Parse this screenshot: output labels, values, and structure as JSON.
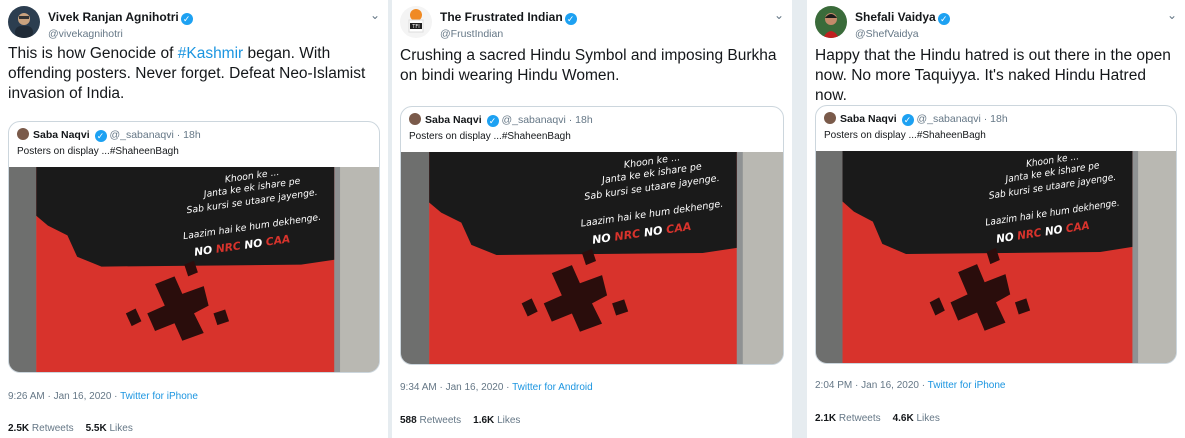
{
  "tweets": [
    {
      "author": "Vivek Ranjan Agnihotri",
      "handle": "@vivekagnihotri",
      "text_before": "This is how Genocide of ",
      "hashtag": "#Kashmir",
      "text_after": " began. With offending posters. Never forget. Defeat Neo-Islamist invasion of India.",
      "time": "9:26 AM · Jan 16, 2020 · ",
      "source": "Twitter for iPhone",
      "retweets_count": "2.5K",
      "retweets_label": "Retweets",
      "likes_count": "5.5K",
      "likes_label": "Likes"
    },
    {
      "author": "The Frustrated Indian",
      "handle": "@FrustIndian",
      "text": "Crushing a sacred Hindu Symbol and imposing Burkha on bindi wearing Hindu Women.",
      "time": "9:34 AM · Jan 16, 2020 · ",
      "source": "Twitter for Android",
      "retweets_count": "588",
      "retweets_label": "Retweets",
      "likes_count": "1.6K",
      "likes_label": "Likes"
    },
    {
      "author": "Shefali Vaidya",
      "handle": "@ShefVaidya",
      "text": "Happy that the Hindu hatred is out there in the open now. No more Taquiyya. It's naked Hindu Hatred now.",
      "time": "2:04 PM · Jan 16, 2020 · ",
      "source": "Twitter for iPhone",
      "retweets_count": "2.1K",
      "retweets_label": "Retweets",
      "likes_count": "4.6K",
      "likes_label": "Likes"
    }
  ],
  "quoted": {
    "author": "Saba Naqvi",
    "handle": "@_sabanaqvi",
    "age": "18h",
    "text": "Posters on display ...#ShaheenBagh",
    "poster_lines": [
      "Khoon ke ...",
      "Janta ke ek ishare pe",
      "Sab kursi se utaare jayenge.",
      "Laazim hai ke hum dekhenge."
    ],
    "poster_slogan_no1": "NO",
    "poster_slogan_nrc": "NRC",
    "poster_slogan_no2": "NO",
    "poster_slogan_caa": "CAA"
  },
  "icons": {
    "verified": "verified-badge-icon",
    "chevron": "chevron-down-icon"
  },
  "colors": {
    "link": "#1b95e0",
    "verified": "#1da1f2",
    "poster_red": "#d8332c",
    "poster_black": "#1a1a1a"
  }
}
